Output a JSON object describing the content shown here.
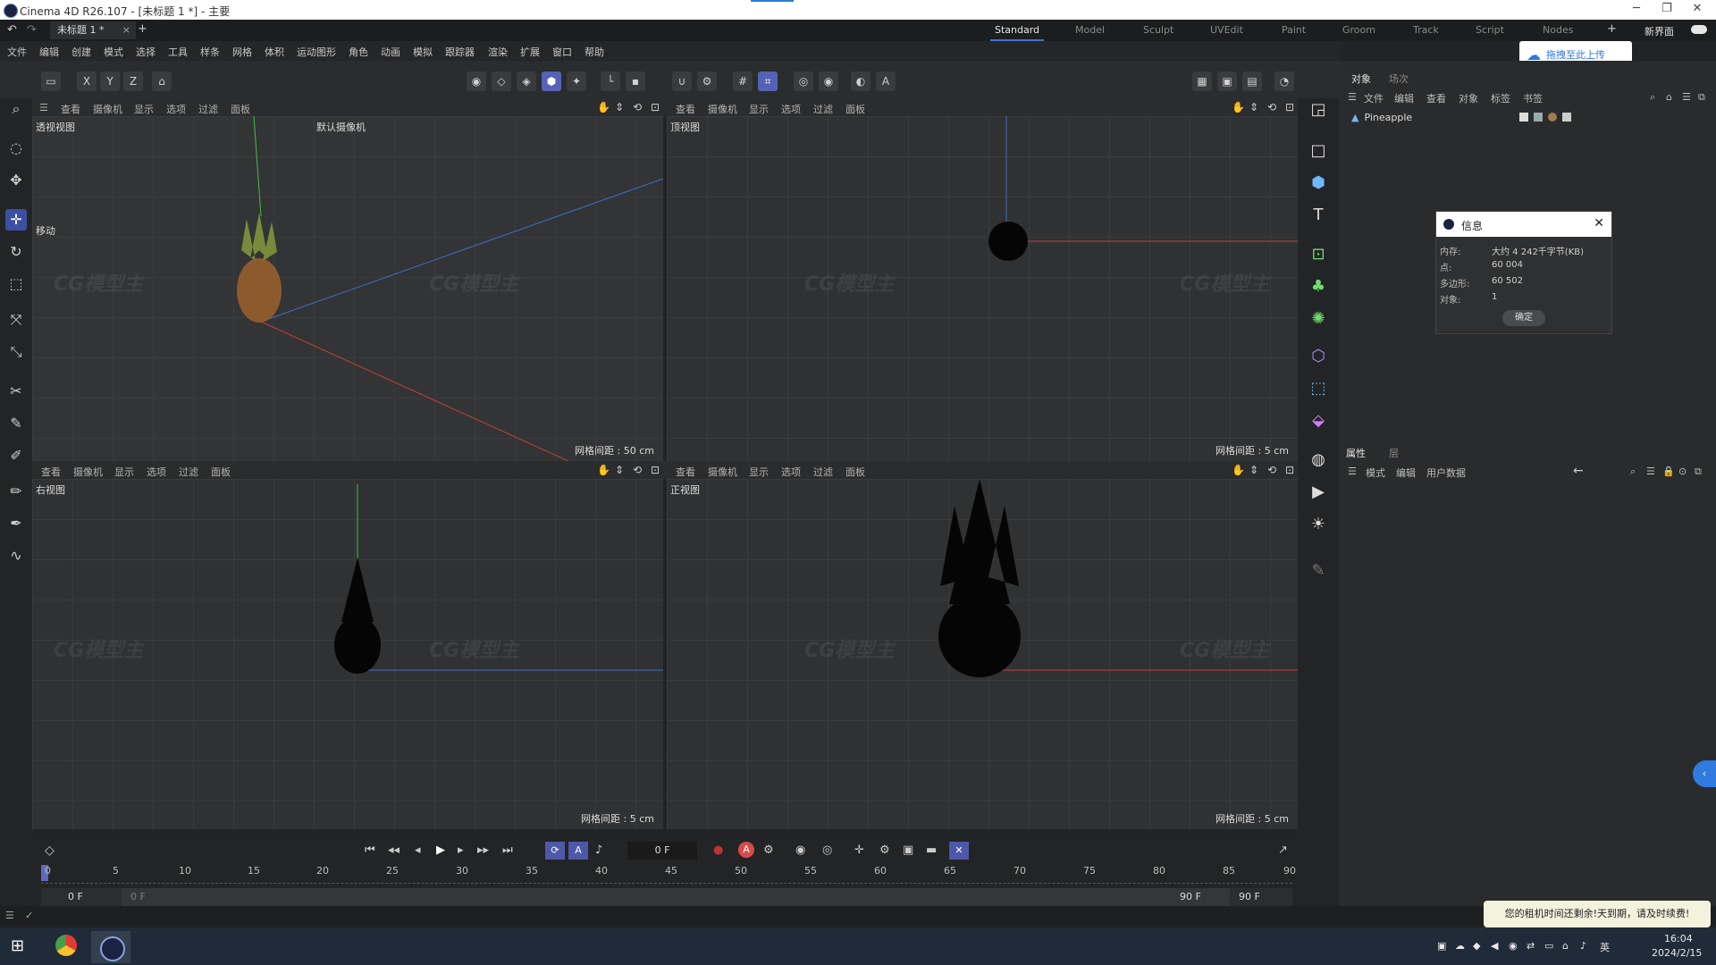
{
  "window": {
    "title": "Cinema 4D R26.107 - [未标题 1 *] - 主要"
  },
  "tabs": {
    "document": "未标题 1 *",
    "add": "+",
    "layouts": [
      "Standard",
      "Model",
      "Sculpt",
      "UVEdit",
      "Paint",
      "Groom",
      "Track",
      "Script",
      "Nodes"
    ],
    "active_layout": "Standard",
    "new_ui_label": "新界面",
    "upload_button": "拖拽至此上传"
  },
  "menu": [
    "文件",
    "编辑",
    "创建",
    "模式",
    "选择",
    "工具",
    "样条",
    "网格",
    "体积",
    "运动图形",
    "角色",
    "动画",
    "模拟",
    "跟踪器",
    "渲染",
    "扩展",
    "窗口",
    "帮助"
  ],
  "toolbar_axes": [
    "X",
    "Y",
    "Z"
  ],
  "viewport_menu": [
    "查看",
    "摄像机",
    "显示",
    "选项",
    "过滤",
    "面板"
  ],
  "viewports": {
    "perspective": {
      "label": "透视视图",
      "camera": "默认摄像机",
      "move_label": "移动",
      "grid": "网格间距 : 50 cm"
    },
    "top": {
      "label": "顶视图",
      "grid": "网格间距 : 5 cm"
    },
    "right": {
      "label": "右视图",
      "grid": "网格间距 : 5 cm"
    },
    "front": {
      "label": "正视图",
      "grid": "网格间距 : 5 cm"
    }
  },
  "objects_panel": {
    "tabs": [
      "对象",
      "场次"
    ],
    "menu": [
      "文件",
      "编辑",
      "查看",
      "对象",
      "标签",
      "书签"
    ],
    "items": [
      "Pineapple"
    ]
  },
  "attributes_panel": {
    "tabs": [
      "属性",
      "层"
    ],
    "menu": [
      "模式",
      "编辑",
      "用户数据"
    ]
  },
  "info_dialog": {
    "title": "信息",
    "rows": [
      {
        "key": "内存:",
        "value": "大约 4 242千字节(KB)"
      },
      {
        "key": "点:",
        "value": "60 004"
      },
      {
        "key": "多边形:",
        "value": "60 502"
      },
      {
        "key": "对象:",
        "value": "1"
      }
    ],
    "ok": "确定"
  },
  "timeline": {
    "frame_field": "0 F",
    "ticks": [
      "0",
      "5",
      "10",
      "15",
      "20",
      "25",
      "30",
      "35",
      "40",
      "45",
      "50",
      "55",
      "60",
      "65",
      "70",
      "75",
      "80",
      "85",
      "90"
    ],
    "start_a": "0 F",
    "start_b": "0 F",
    "end_a": "90 F",
    "end_b": "90 F"
  },
  "notice": "您的租机时间还剩余!天到期，请及时续费!",
  "taskbar": {
    "ime": "英",
    "time": "16:04",
    "date": "2024/2/15"
  },
  "watermark": "CG模型主"
}
